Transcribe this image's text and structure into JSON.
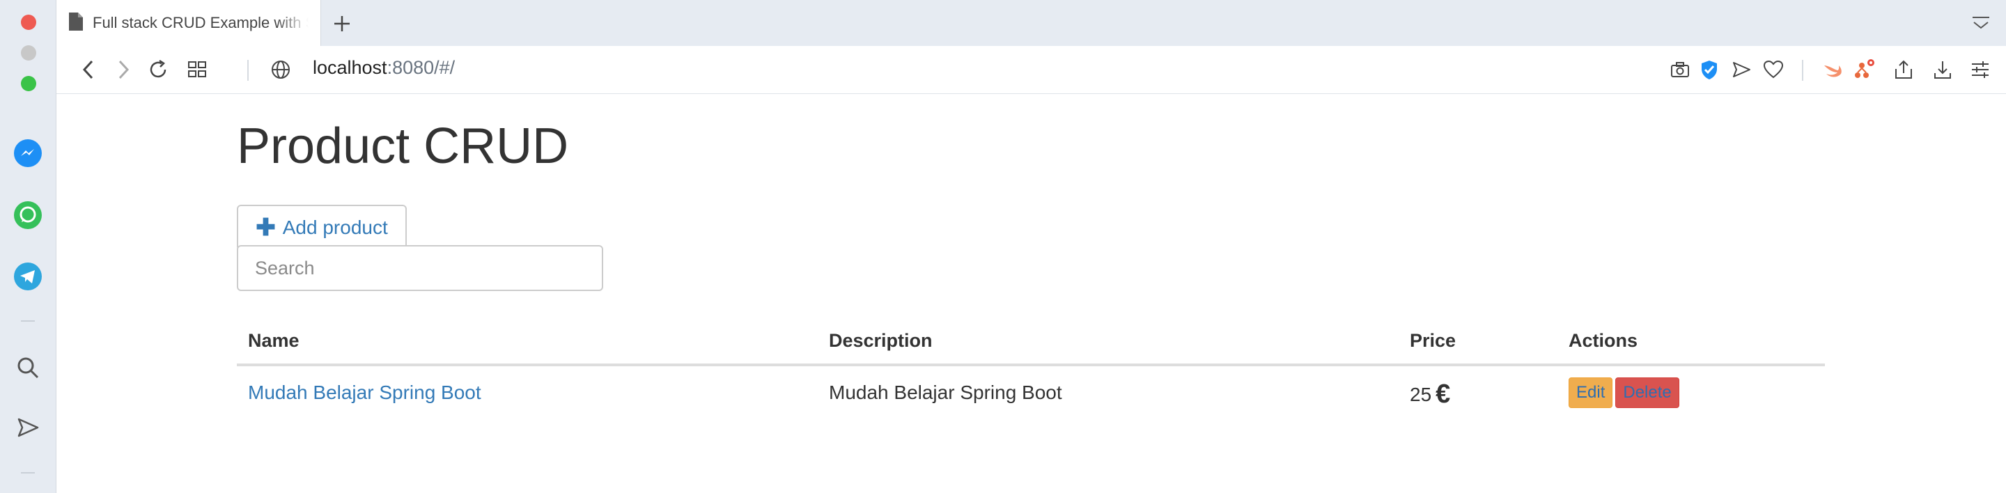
{
  "browser": {
    "tab_title": "Full stack CRUD Example with Spring Boot",
    "url_host": "localhost",
    "url_rest": ":8080/#/",
    "colors": {
      "sidebar_bg": "#e6ebf2",
      "close_dot": "#ee5a52",
      "zoom_dot": "#3ac348"
    }
  },
  "sidebar": {
    "apps": [
      "messenger-icon",
      "whatsapp-icon",
      "telegram-icon"
    ],
    "tools": [
      "search-icon",
      "send-icon"
    ]
  },
  "page": {
    "title": "Product CRUD",
    "add_button_label": "Add product",
    "search_placeholder": "Search",
    "columns": [
      "Name",
      "Description",
      "Price",
      "Actions"
    ],
    "rows": [
      {
        "name": "Mudah Belajar Spring Boot",
        "description": "Mudah Belajar Spring Boot",
        "price": "25",
        "currency": "€",
        "edit_label": "Edit",
        "delete_label": "Delete"
      }
    ],
    "colors": {
      "link": "#337ab7",
      "edit": "#f0ad4e",
      "delete": "#d9534f"
    }
  }
}
